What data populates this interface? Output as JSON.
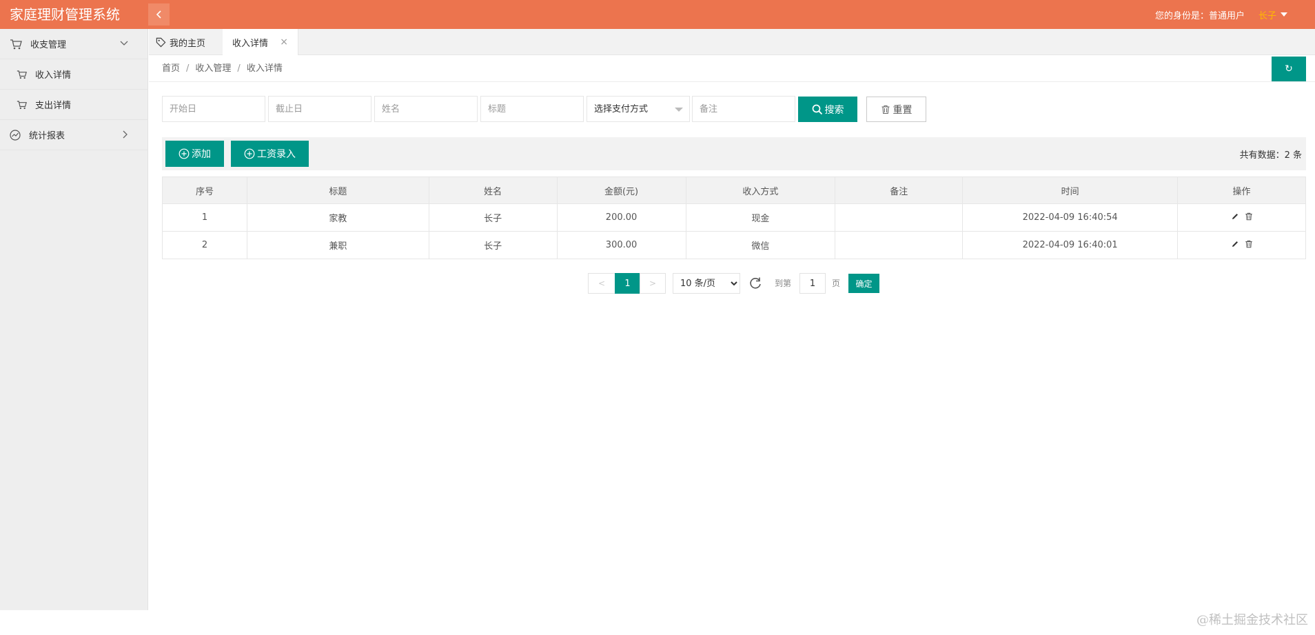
{
  "header": {
    "app_title": "家庭理财管理系统",
    "identity_label": "您的身份是：普通用户",
    "user_name": "长子"
  },
  "colors": {
    "header_bg": "#ec744e",
    "primary": "#009688",
    "user_accent": "#ffb800"
  },
  "sidebar": {
    "groups": [
      {
        "label": "收支管理",
        "icon": "cart-icon",
        "expanded": true,
        "children": [
          {
            "label": "收入详情",
            "icon": "cart-icon"
          },
          {
            "label": "支出详情",
            "icon": "cart-icon"
          }
        ]
      },
      {
        "label": "统计报表",
        "icon": "chart-line-icon",
        "expanded": false
      }
    ]
  },
  "tabs": {
    "home": "我的主页",
    "active": "收入详情",
    "close_glyph": "×"
  },
  "breadcrumb": [
    "首页",
    "收入管理",
    "收入详情"
  ],
  "breadcrumb_sep": "/",
  "refresh_glyph": "↻",
  "search": {
    "start_date_placeholder": "开始日",
    "end_date_placeholder": "截止日",
    "name_placeholder": "姓名",
    "title_placeholder": "标题",
    "pay_method_selected": "选择支付方式",
    "note_placeholder": "备注",
    "search_label": "搜索",
    "reset_label": "重置"
  },
  "toolbar": {
    "add_label": "添加",
    "salary_label": "工资录入",
    "total_text": "共有数据：2 条"
  },
  "table": {
    "columns": [
      "序号",
      "标题",
      "姓名",
      "金额(元)",
      "收入方式",
      "备注",
      "时间",
      "操作"
    ],
    "rows": [
      [
        "1",
        "家教",
        "长子",
        "200.00",
        "现金",
        "",
        "2022-04-09 16:40:54"
      ],
      [
        "2",
        "兼职",
        "长子",
        "300.00",
        "微信",
        "",
        "2022-04-09 16:40:01"
      ]
    ]
  },
  "pagination": {
    "prev": "<",
    "next": ">",
    "current_page": "1",
    "page_size_selected": "10 条/页",
    "goto_label": "到第",
    "page_input_value": "1",
    "page_unit": "页",
    "confirm_label": "确定"
  },
  "corner_watermark": "@稀土掘金技术社区"
}
